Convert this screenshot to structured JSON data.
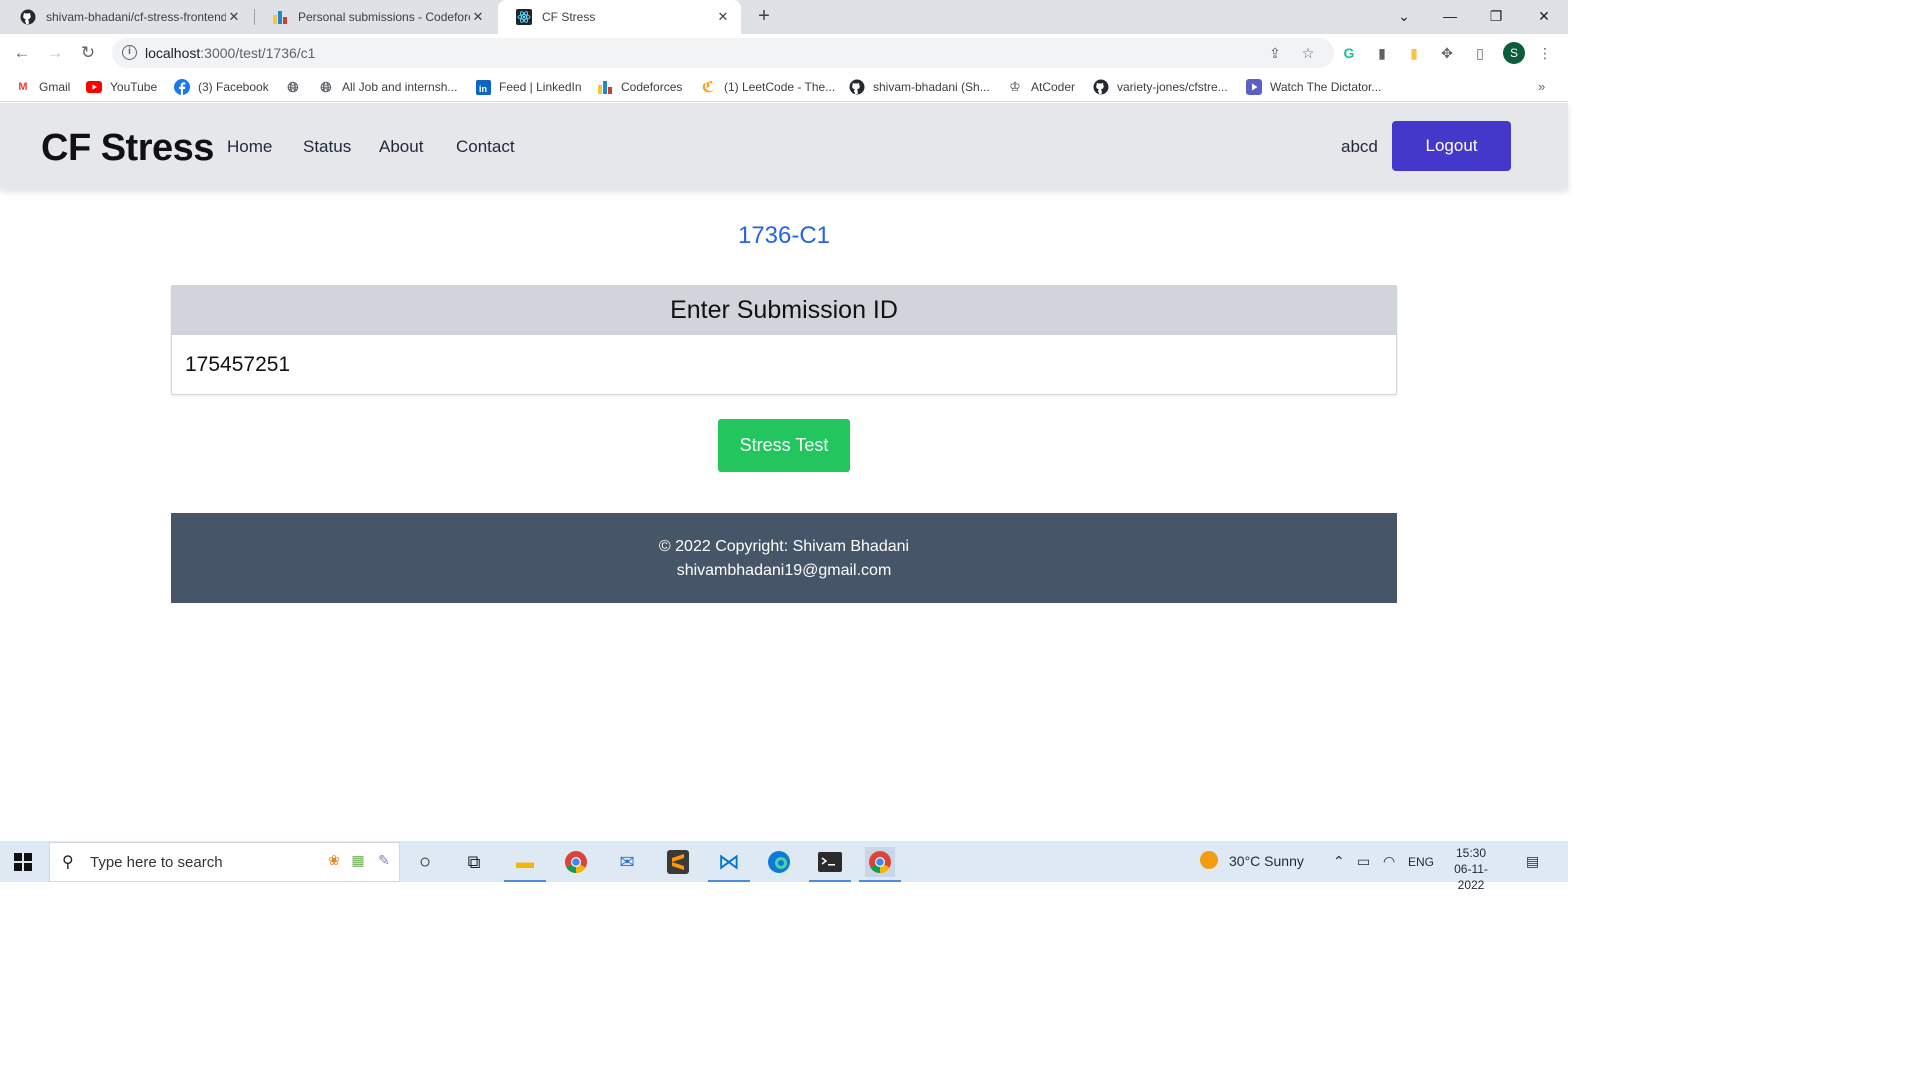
{
  "browser": {
    "tabs": [
      {
        "title": "shivam-bhadani/cf-stress-frontend",
        "icon": "github-icon"
      },
      {
        "title": "Personal submissions - Codeforces",
        "icon": "codeforces-icon"
      },
      {
        "title": "CF Stress",
        "icon": "react-icon"
      }
    ],
    "url_host": "localhost",
    "url_path": ":3000/test/1736/c1",
    "profile_initial": "S",
    "bookmarks": [
      {
        "label": "Gmail"
      },
      {
        "label": "YouTube"
      },
      {
        "label": "(3) Facebook"
      },
      {
        "label": ""
      },
      {
        "label": "All Job and internsh..."
      },
      {
        "label": "Feed | LinkedIn"
      },
      {
        "label": "Codeforces"
      },
      {
        "label": "(1) LeetCode - The..."
      },
      {
        "label": "shivam-bhadani (Sh..."
      },
      {
        "label": "AtCoder"
      },
      {
        "label": "variety-jones/cfstre..."
      },
      {
        "label": "Watch The Dictator..."
      }
    ],
    "bookmarks_more": "»"
  },
  "navbar": {
    "brand": "CF Stress",
    "links": [
      "Home",
      "Status",
      "About",
      "Contact"
    ],
    "username": "abcd",
    "logout_label": "Logout"
  },
  "main": {
    "problem_id": "1736-C1",
    "card_title": "Enter Submission ID",
    "submission_id_value": "175457251",
    "stress_button_label": "Stress Test"
  },
  "footer": {
    "copyright": "© 2022 Copyright: Shivam Bhadani",
    "email": "shivambhadani19@gmail.com"
  },
  "taskbar": {
    "search_placeholder": "Type here to search",
    "weather": "30°C  Sunny",
    "language": "ENG",
    "time": "15:30",
    "date": "06-11-2022"
  },
  "colors": {
    "navbar_bg": "#e5e7eb",
    "logout_bg": "#4338ca",
    "problem_id": "#2563eb",
    "card_header_bg": "#d1d5db",
    "stress_button_bg": "#22c55e",
    "footer_bg": "#475569"
  }
}
